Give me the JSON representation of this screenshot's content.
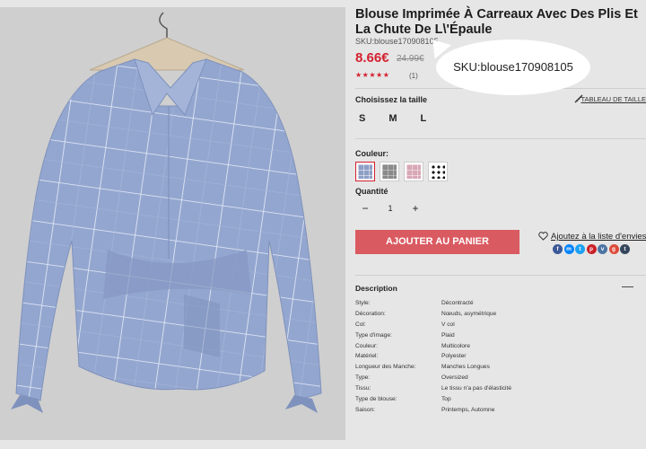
{
  "product": {
    "title": "Blouse Imprimée À Carreaux Avec Des Plis Et La Chute De L\\'Épaule",
    "sku": "SKU:blouse170908105",
    "price": "8.66€",
    "old_price": "24.99€",
    "stars": "★★★★★",
    "reviews": "(1)",
    "rating": 5
  },
  "callout": {
    "text": "SKU:blouse170908105"
  },
  "size": {
    "label": "Choisissez la taille",
    "guide": "TABLEAU DE TAILLE",
    "options": [
      "S",
      "M",
      "L"
    ]
  },
  "color": {
    "label": "Couleur:",
    "swatches": [
      {
        "name": "blue-plaid",
        "hex": "#8e9fc5",
        "selected": true
      },
      {
        "name": "grey",
        "hex": "#8a8a8a",
        "selected": false
      },
      {
        "name": "pink",
        "hex": "#d8a8b6",
        "selected": false
      },
      {
        "name": "polka-dot",
        "hex": "#222222",
        "selected": false
      }
    ]
  },
  "quantity": {
    "label": "Quantité",
    "minus": "−",
    "value": "1",
    "plus": "+"
  },
  "actions": {
    "add_to_cart": "AJOUTER AU PANIER",
    "wishlist": "Ajoutez à la liste d'envies"
  },
  "socials": [
    {
      "name": "facebook-icon",
      "glyph": "f",
      "color": "#3b5998"
    },
    {
      "name": "messenger-icon",
      "glyph": "m",
      "color": "#0084ff"
    },
    {
      "name": "twitter-icon",
      "glyph": "t",
      "color": "#1da1f2"
    },
    {
      "name": "pinterest-icon",
      "glyph": "p",
      "color": "#cb2027"
    },
    {
      "name": "vk-icon",
      "glyph": "v",
      "color": "#4c75a3"
    },
    {
      "name": "google-plus-icon",
      "glyph": "g",
      "color": "#dd4b39"
    },
    {
      "name": "tumblr-icon",
      "glyph": "t",
      "color": "#35465c"
    }
  ],
  "description": {
    "title": "Description",
    "toggle": "—",
    "specs": [
      {
        "k": "Style:",
        "v": "Décontracté"
      },
      {
        "k": "Décoration:",
        "v": "Nœuds, asymétrique"
      },
      {
        "k": "Col:",
        "v": "V col"
      },
      {
        "k": "Type d'image:",
        "v": "Plaid"
      },
      {
        "k": "Couleur:",
        "v": "Multicolore"
      },
      {
        "k": "Matériel:",
        "v": "Polyester"
      },
      {
        "k": "Longueur des Manche:",
        "v": "Manches Longues"
      },
      {
        "k": "Type:",
        "v": "Oversized"
      },
      {
        "k": "Tissu:",
        "v": "Le tissu n'a pas d'élasticité"
      },
      {
        "k": "Type de blouse:",
        "v": "Top"
      },
      {
        "k": "Saison:",
        "v": "Printemps, Automne"
      }
    ]
  },
  "colors": {
    "accent": "#d4202f",
    "button": "#da5a61",
    "background": "#e6e6e6"
  }
}
